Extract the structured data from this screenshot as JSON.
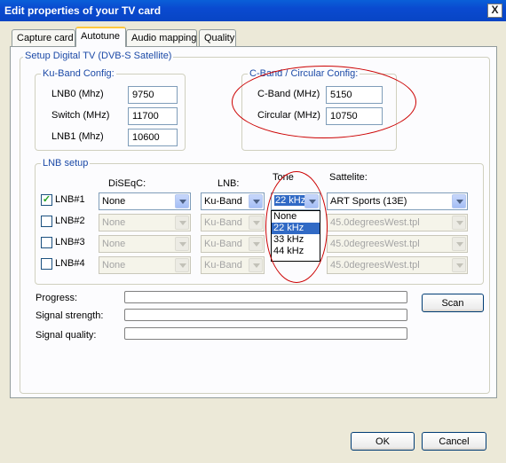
{
  "window": {
    "title": "Edit properties of your TV card",
    "close": "X"
  },
  "tabs": [
    {
      "label": "Capture card"
    },
    {
      "label": "Autotune"
    },
    {
      "label": "Audio mapping"
    },
    {
      "label": "Quality"
    }
  ],
  "setup_group": "Setup Digital TV (DVB-S Satellite)",
  "ku_band": {
    "title": "Ku-Band Config:",
    "lnb0_label": "LNB0 (Mhz)",
    "lnb0_value": "9750",
    "switch_label": "Switch (MHz)",
    "switch_value": "11700",
    "lnb1_label": "LNB1 (Mhz)",
    "lnb1_value": "10600"
  },
  "c_band": {
    "title": "C-Band / Circular Config:",
    "cband_label": "C-Band (MHz)",
    "cband_value": "5150",
    "circular_label": "Circular (MHz)",
    "circular_value": "10750"
  },
  "lnb_setup": {
    "title": "LNB setup",
    "headers": {
      "diseqc": "DiSEqC:",
      "lnb": "LNB:",
      "tone": "Tone",
      "satellite": "Sattelite:"
    },
    "rows": [
      {
        "label": "LNB#1",
        "checked": true,
        "diseqc": "None",
        "lnb": "Ku-Band",
        "tone": "22 kHz",
        "satellite": "ART Sports (13E)"
      },
      {
        "label": "LNB#2",
        "checked": false,
        "diseqc": "None",
        "lnb": "Ku-Band",
        "tone": "",
        "satellite": "45.0degreesWest.tpl"
      },
      {
        "label": "LNB#3",
        "checked": false,
        "diseqc": "None",
        "lnb": "Ku-Band",
        "tone": "",
        "satellite": "45.0degreesWest.tpl"
      },
      {
        "label": "LNB#4",
        "checked": false,
        "diseqc": "None",
        "lnb": "Ku-Band",
        "tone": "",
        "satellite": "45.0degreesWest.tpl"
      }
    ],
    "tone_options": [
      "None",
      "22 kHz",
      "33 kHz",
      "44 kHz"
    ],
    "tone_selected": "22 kHz"
  },
  "status": {
    "progress_label": "Progress:",
    "signal_strength_label": "Signal strength:",
    "signal_quality_label": "Signal quality:",
    "scan_button": "Scan"
  },
  "footer": {
    "ok": "OK",
    "cancel": "Cancel"
  },
  "colors": {
    "titlebar": "#0a4ad0",
    "group_label": "#1c4aa7",
    "selection": "#316ac5",
    "annotation": "#cc0000"
  }
}
